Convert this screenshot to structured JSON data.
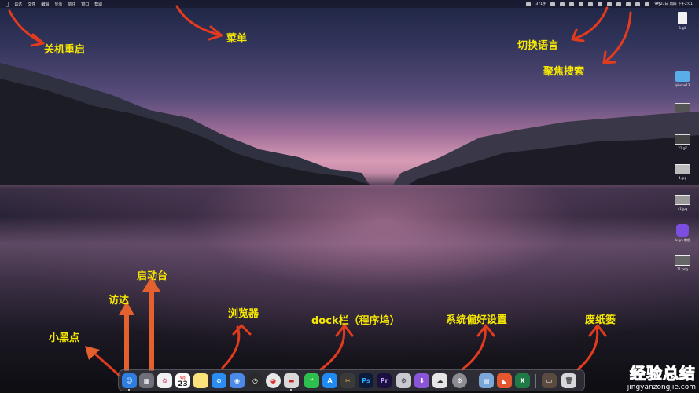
{
  "menubar": {
    "items": [
      "访达",
      "文件",
      "编辑",
      "显示",
      "前往",
      "窗口",
      "帮助"
    ],
    "tray_indicator": "371字",
    "datetime": "9月23日 周四 下午2:01"
  },
  "annotations": {
    "shutdown_restart": "关机重启",
    "menu": "菜单",
    "switch_language": "切换语言",
    "spotlight": "聚焦搜索",
    "launchpad": "启动台",
    "finder": "访达",
    "little_black_dot": "小黑点",
    "browser": "浏览器",
    "dock_bar": "dock栏（程序坞）",
    "system_preferences": "系统偏好设置",
    "trash": "废纸篓"
  },
  "desktop_items": [
    {
      "label": "1.gif",
      "icon": "gif-file-icon"
    },
    {
      "label": "iphone13",
      "icon": "folder-icon"
    },
    {
      "label": "",
      "icon": "screenshot-thumbnail-icon"
    },
    {
      "label": "22.gif",
      "icon": "screenshot-thumbnail-icon"
    },
    {
      "label": "4.jpg",
      "icon": "image-thumbnail-icon"
    },
    {
      "label": "41.jpg",
      "icon": "image-thumbnail-icon"
    },
    {
      "label": "ikuya 教程",
      "icon": "purple-app-icon"
    },
    {
      "label": "11.png",
      "icon": "image-thumbnail-icon"
    }
  ],
  "dock": {
    "calendar_day": "23",
    "calendar_month": "9月",
    "ps_label": "Ps",
    "pr_label": "Pr",
    "icons": [
      {
        "name": "finder-icon",
        "color": "#2d7ee0"
      },
      {
        "name": "launchpad-icon",
        "color": "#6f6f7a"
      },
      {
        "name": "photos-icon",
        "color": "#f2f2f2"
      },
      {
        "name": "calendar-icon",
        "color": "#ffffff"
      },
      {
        "name": "notes-icon",
        "color": "#fbe27a"
      },
      {
        "name": "safari-icon",
        "color": "#2b8df3"
      },
      {
        "name": "chrome-alt-icon",
        "color": "#4a8ae8"
      },
      {
        "name": "clock-icon",
        "color": "#2a2a2a"
      },
      {
        "name": "chrome-icon",
        "color": "#e8e8e8"
      },
      {
        "name": "video-player-icon",
        "color": "#d9d9d9"
      },
      {
        "name": "wechat-icon",
        "color": "#2ec04f"
      },
      {
        "name": "app-store-icon",
        "color": "#1f8bf2"
      },
      {
        "name": "final-cut-icon",
        "color": "#3a3a3a"
      },
      {
        "name": "photoshop-icon",
        "color": "#0c1b3a"
      },
      {
        "name": "premiere-icon",
        "color": "#1b1040"
      },
      {
        "name": "dashboard-icon",
        "color": "#c9c9d2"
      },
      {
        "name": "purple-app-icon",
        "color": "#8a55d8"
      },
      {
        "name": "qq-icon",
        "color": "#e6e6e6"
      },
      {
        "name": "system-preferences-icon",
        "color": "#8c8c92"
      },
      {
        "name": "preview-icon",
        "color": "#7aa7d8"
      },
      {
        "name": "office-icon",
        "color": "#e4572e"
      },
      {
        "name": "excel-icon",
        "color": "#1f7a45"
      },
      {
        "name": "photo-folder-icon",
        "color": "#5a4a40"
      },
      {
        "name": "trash-icon",
        "color": "#d8d8dc"
      }
    ]
  },
  "watermark": {
    "title": "经验总结",
    "url": "jingyanzongjie.com"
  },
  "colors": {
    "annotation": "#f6e800",
    "arrow": "#e23b1e"
  }
}
